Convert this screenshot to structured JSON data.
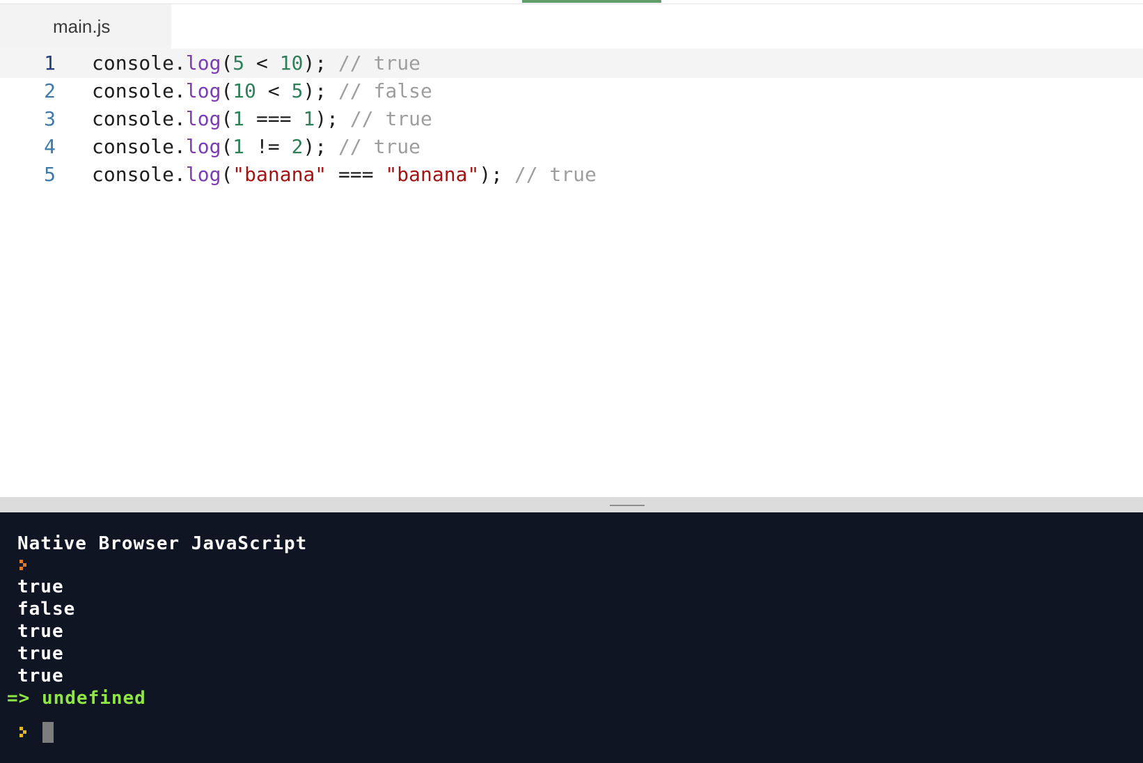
{
  "tab": {
    "label": "main.js"
  },
  "editor": {
    "lines": [
      {
        "number": "1",
        "tokens": [
          {
            "t": "obj",
            "v": "console."
          },
          {
            "t": "fn",
            "v": "log"
          },
          {
            "t": "op",
            "v": "("
          },
          {
            "t": "num",
            "v": "5"
          },
          {
            "t": "op",
            "v": " < "
          },
          {
            "t": "num",
            "v": "10"
          },
          {
            "t": "op",
            "v": "); "
          },
          {
            "t": "com",
            "v": "// true"
          }
        ]
      },
      {
        "number": "2",
        "tokens": [
          {
            "t": "obj",
            "v": "console."
          },
          {
            "t": "fn",
            "v": "log"
          },
          {
            "t": "op",
            "v": "("
          },
          {
            "t": "num",
            "v": "10"
          },
          {
            "t": "op",
            "v": " < "
          },
          {
            "t": "num",
            "v": "5"
          },
          {
            "t": "op",
            "v": "); "
          },
          {
            "t": "com",
            "v": "// false"
          }
        ]
      },
      {
        "number": "3",
        "tokens": [
          {
            "t": "obj",
            "v": "console."
          },
          {
            "t": "fn",
            "v": "log"
          },
          {
            "t": "op",
            "v": "("
          },
          {
            "t": "num",
            "v": "1"
          },
          {
            "t": "op",
            "v": " === "
          },
          {
            "t": "num",
            "v": "1"
          },
          {
            "t": "op",
            "v": "); "
          },
          {
            "t": "com",
            "v": "// true"
          }
        ]
      },
      {
        "number": "4",
        "tokens": [
          {
            "t": "obj",
            "v": "console."
          },
          {
            "t": "fn",
            "v": "log"
          },
          {
            "t": "op",
            "v": "("
          },
          {
            "t": "num",
            "v": "1"
          },
          {
            "t": "op",
            "v": " != "
          },
          {
            "t": "num",
            "v": "2"
          },
          {
            "t": "op",
            "v": "); "
          },
          {
            "t": "com",
            "v": "// true"
          }
        ]
      },
      {
        "number": "5",
        "tokens": [
          {
            "t": "obj",
            "v": "console."
          },
          {
            "t": "fn",
            "v": "log"
          },
          {
            "t": "op",
            "v": "("
          },
          {
            "t": "str",
            "v": "\"banana\""
          },
          {
            "t": "op",
            "v": " === "
          },
          {
            "t": "str",
            "v": "\"banana\""
          },
          {
            "t": "op",
            "v": "); "
          },
          {
            "t": "com",
            "v": "// true"
          }
        ]
      }
    ]
  },
  "console": {
    "header": "Native Browser JavaScript",
    "outputs": [
      "true",
      "false",
      "true",
      "true",
      "true"
    ],
    "result": "=> undefined",
    "prompt_icon_colors": [
      "#e07b2a",
      "#e0b62a"
    ]
  }
}
